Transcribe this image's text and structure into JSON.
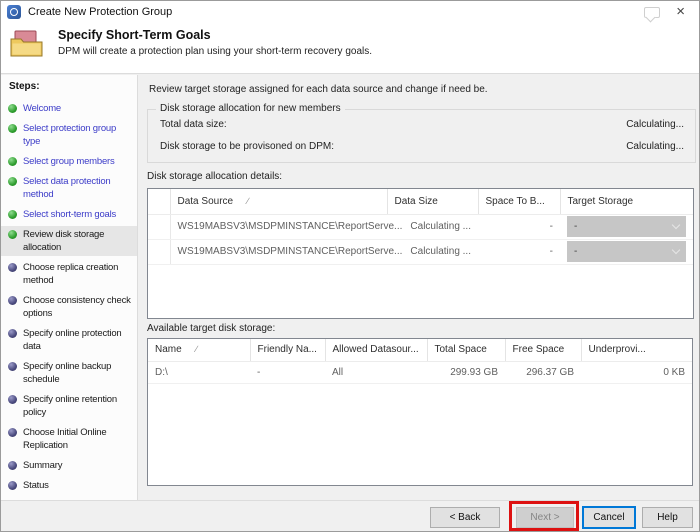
{
  "window": {
    "title": "Create New Protection Group"
  },
  "icons": {
    "close": "×",
    "sort_ascending": "∕"
  },
  "colors": {
    "annotation_red": "#dd1111",
    "focus_blue": "#0078d7",
    "link_blue": "#3c3cc8",
    "step_done_green": "#2f9e2f",
    "step_todo_purple": "#4a4a7e"
  },
  "header": {
    "title": "Specify Short-Term Goals",
    "subtitle": "DPM will create a protection plan using your short-term recovery goals."
  },
  "sidebar": {
    "label": "Steps:",
    "steps": [
      {
        "label": "Welcome",
        "state": "done"
      },
      {
        "label": "Select protection group type",
        "state": "done"
      },
      {
        "label": "Select group members",
        "state": "done"
      },
      {
        "label": "Select data protection method",
        "state": "done"
      },
      {
        "label": "Select short-term goals",
        "state": "done"
      },
      {
        "label": "Review disk storage allocation",
        "state": "current"
      },
      {
        "label": "Choose replica creation method",
        "state": "todo"
      },
      {
        "label": "Choose consistency check options",
        "state": "todo"
      },
      {
        "label": "Specify online protection data",
        "state": "todo"
      },
      {
        "label": "Specify online backup schedule",
        "state": "todo"
      },
      {
        "label": "Specify online retention policy",
        "state": "todo"
      },
      {
        "label": "Choose Initial Online Replication",
        "state": "todo"
      },
      {
        "label": "Summary",
        "state": "todo"
      },
      {
        "label": "Status",
        "state": "todo"
      }
    ]
  },
  "main": {
    "intro": "Review target storage assigned for each data source and change if need be.",
    "allocation_box": {
      "legend": "Disk storage allocation for new members",
      "rows": [
        {
          "label": "Total data size:",
          "value": "Calculating..."
        },
        {
          "label": "Disk storage to be provisoned on DPM:",
          "value": "Calculating..."
        }
      ]
    },
    "details": {
      "label": "Disk storage allocation details:",
      "columns": [
        "Data Source",
        "Data Size",
        "Space To B...",
        "Target Storage"
      ],
      "rows": [
        {
          "data_source": "WS19MABSV3\\MSDPMINSTANCE\\ReportServe...",
          "data_size": "Calculating ...",
          "space": "-",
          "target": "-"
        },
        {
          "data_source": "WS19MABSV3\\MSDPMINSTANCE\\ReportServe...",
          "data_size": "Calculating ...",
          "space": "-",
          "target": "-"
        }
      ]
    },
    "available": {
      "label": "Available target disk storage:",
      "columns": [
        "Name",
        "Friendly Na...",
        "Allowed Datasour...",
        "Total Space",
        "Free Space",
        "Underprovi..."
      ],
      "rows": [
        {
          "name": "D:\\",
          "friendly": "-",
          "allowed": "All",
          "total": "299.93 GB",
          "free": "296.37 GB",
          "under": "0 KB"
        }
      ]
    }
  },
  "footer": {
    "back": "< Back",
    "next": "Next >",
    "cancel": "Cancel",
    "help": "Help"
  }
}
